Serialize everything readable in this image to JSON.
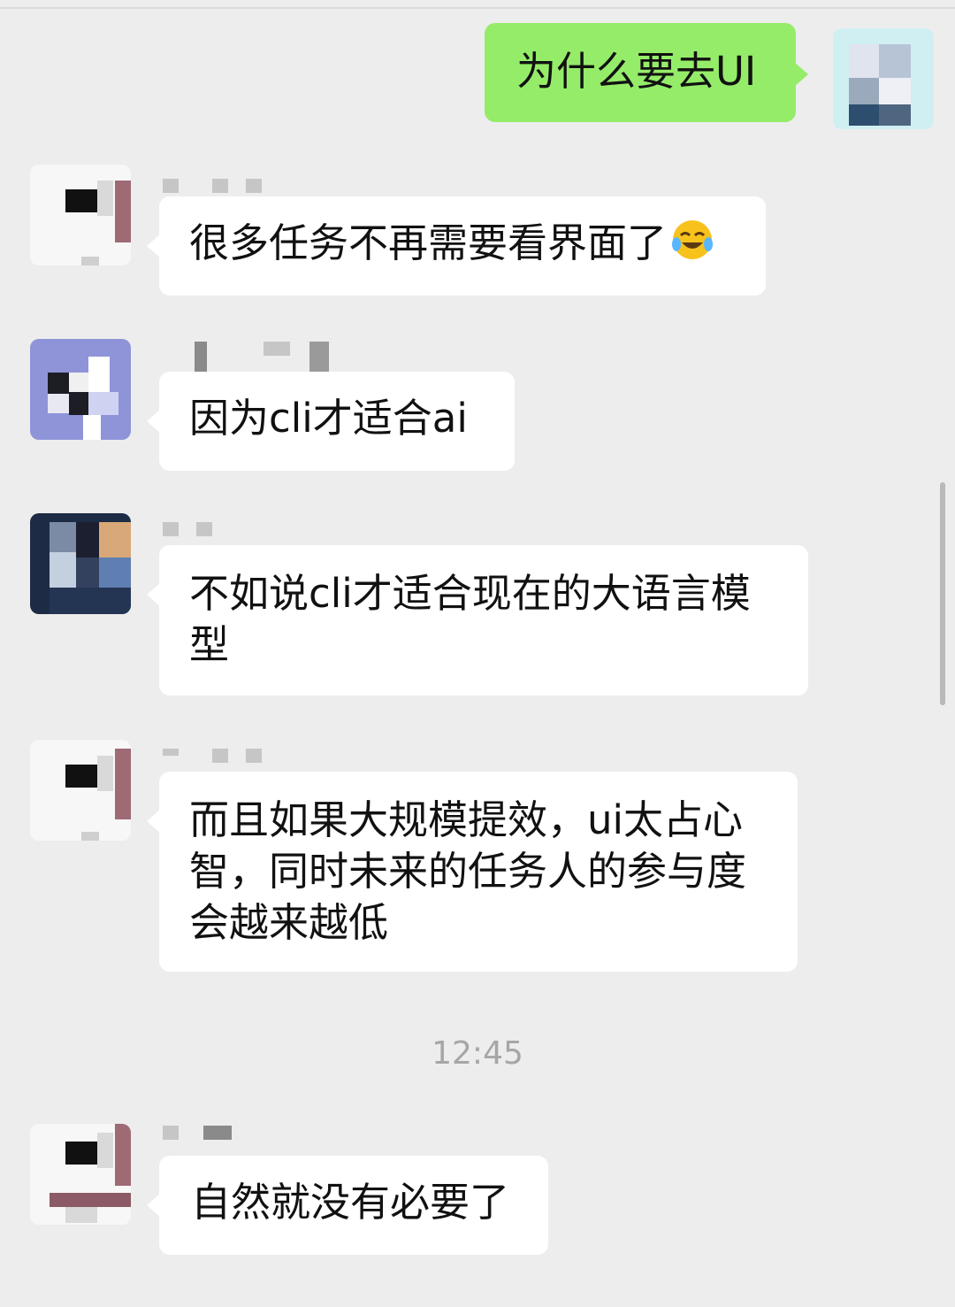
{
  "messages": [
    {
      "id": "m1",
      "from": "self",
      "text": "为什么要去UI"
    },
    {
      "id": "m2",
      "from": "other",
      "text": "很多任务不再需要看界面了",
      "emoji": "face-with-tears-of-joy-icon"
    },
    {
      "id": "m3",
      "from": "other",
      "text": "因为cli才适合ai"
    },
    {
      "id": "m4",
      "from": "other",
      "text": "不如说cli才适合现在的大语言模型"
    },
    {
      "id": "m5",
      "from": "other",
      "text": "而且如果大规模提效，ui太占心智，同时未来的任务人的参与度会越来越低"
    },
    {
      "id": "m6",
      "from": "other",
      "text": "自然就没有必要了"
    }
  ],
  "timestamp": "12:45",
  "colors": {
    "background": "#ededed",
    "self_bubble": "#95ec69",
    "other_bubble": "#ffffff",
    "timestamp": "#a6a6a6"
  }
}
